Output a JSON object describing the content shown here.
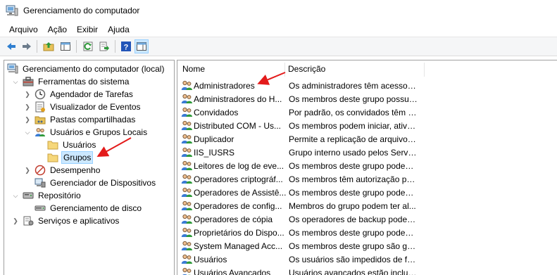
{
  "window": {
    "title": "Gerenciamento do computador"
  },
  "menu": {
    "items": [
      "Arquivo",
      "Ação",
      "Exibir",
      "Ajuda"
    ]
  },
  "toolbar": {
    "buttons": [
      "back-icon",
      "forward-icon",
      "up-folder-icon",
      "show-hide-tree-icon",
      "refresh-icon",
      "export-list-icon",
      "help-icon",
      "action-pane-icon"
    ]
  },
  "tree": {
    "root": "Gerenciamento do computador (local)",
    "system_tools": "Ferramentas do sistema",
    "task_scheduler": "Agendador de Tarefas",
    "event_viewer": "Visualizador de Eventos",
    "shared_folders": "Pastas compartilhadas",
    "local_users_groups": "Usuários e Grupos Locais",
    "users": "Usuários",
    "groups": "Grupos",
    "performance": "Desempenho",
    "device_manager": "Gerenciador de Dispositivos",
    "storage": "Repositório",
    "disk_management": "Gerenciamento de disco",
    "services_apps": "Serviços e aplicativos"
  },
  "list": {
    "columns": {
      "name": "Nome",
      "description": "Descrição"
    },
    "rows": [
      {
        "name": "Administradores",
        "desc": "Os administradores têm acesso c..."
      },
      {
        "name": "Administradores do H...",
        "desc": "Os membros deste grupo possue..."
      },
      {
        "name": "Convidados",
        "desc": "Por padrão, os convidados têm o ..."
      },
      {
        "name": "Distributed COM - Us...",
        "desc": "Os membros podem iniciar, ativar..."
      },
      {
        "name": "Duplicador",
        "desc": "Permite a replicação de arquivos ..."
      },
      {
        "name": "IIS_IUSRS",
        "desc": "Grupo interno usado pelos Serviç..."
      },
      {
        "name": "Leitores de log de eve...",
        "desc": "Os membros deste grupo podem ..."
      },
      {
        "name": "Operadores criptográf...",
        "desc": "Os membros têm autorização par..."
      },
      {
        "name": "Operadores de Assistê...",
        "desc": "Os membros deste grupo podem ..."
      },
      {
        "name": "Operadores de config...",
        "desc": "Membros do grupo podem ter al..."
      },
      {
        "name": "Operadores de cópia",
        "desc": "Os operadores de backup podem ..."
      },
      {
        "name": "Proprietários do Dispo...",
        "desc": "Os membros deste grupo podem ..."
      },
      {
        "name": "System Managed Acc...",
        "desc": "Os membros deste grupo são ger..."
      },
      {
        "name": "Usuários",
        "desc": "Os usuários são impedidos de faz..."
      },
      {
        "name": "Usuários Avançados",
        "desc": "Usuários avançados estão incluíd..."
      }
    ]
  },
  "colors": {
    "annotation_arrow": "#e31b1b",
    "selection": "#cce8ff"
  }
}
